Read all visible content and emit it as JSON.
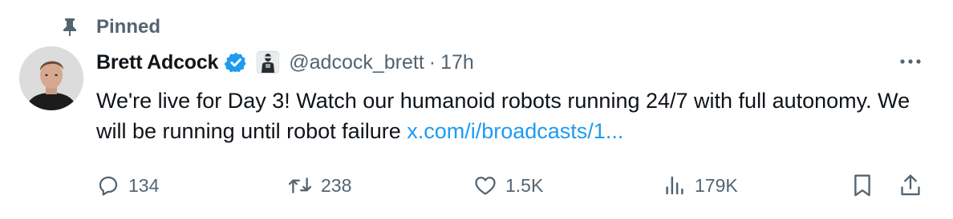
{
  "pinned": {
    "label": "Pinned",
    "icon": "pin-icon"
  },
  "author": {
    "name": "Brett Adcock",
    "handle": "@adcock_brett",
    "separator": "·",
    "time": "17h",
    "verified_icon": "verified-badge-icon",
    "affiliate_icon": "robot-affiliate-badge"
  },
  "tweet": {
    "text": "We're live for Day 3! Watch our humanoid robots running 24/7 with full autonomy. We will be running until robot failure ",
    "link": "x.com/i/broadcasts/1..."
  },
  "actions": {
    "replies": "134",
    "retweets": "238",
    "likes": "1.5K",
    "views": "179K"
  },
  "colors": {
    "text": "#0f1419",
    "secondary": "#536471",
    "link": "#1d9bf0",
    "verified": "#1d9bf0"
  }
}
